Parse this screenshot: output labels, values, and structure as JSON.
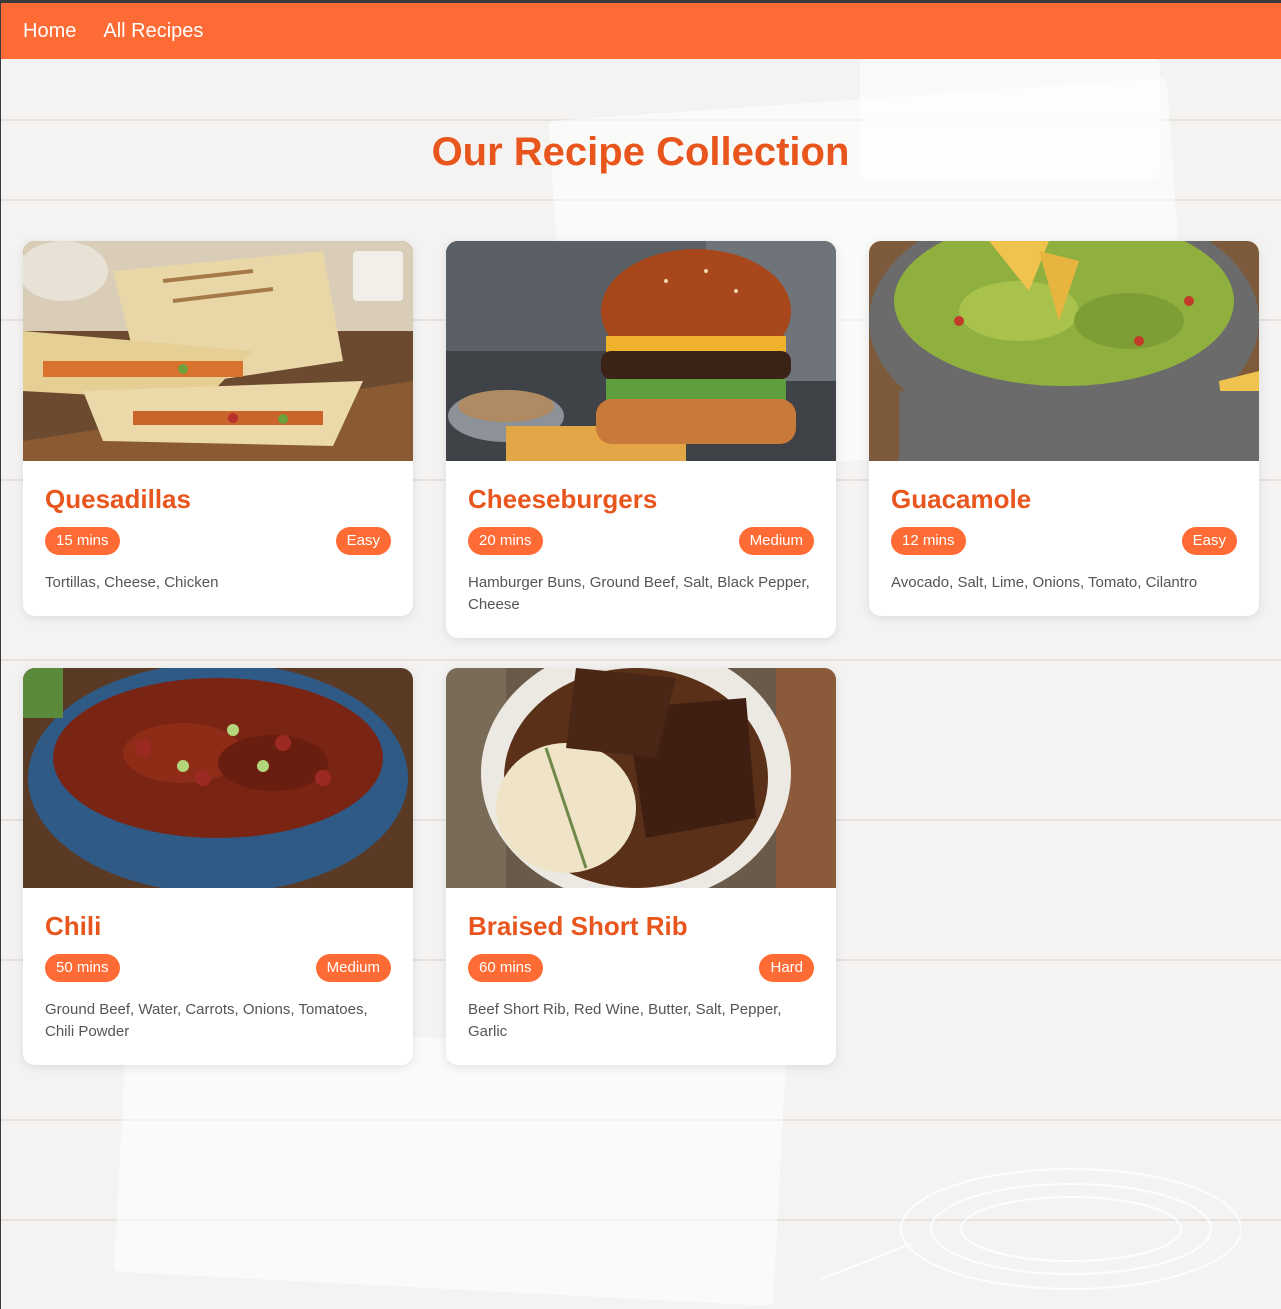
{
  "nav": {
    "home": "Home",
    "all_recipes": "All Recipes"
  },
  "page": {
    "title": "Our Recipe Collection"
  },
  "colors": {
    "accent": "#ff6b35",
    "title": "#e8561e",
    "text": "#555555"
  },
  "recipes": [
    {
      "name": "Quesadillas",
      "time": "15 mins",
      "difficulty": "Easy",
      "ingredients": "Tortillas, Cheese, Chicken",
      "image": "quesadilla-photo"
    },
    {
      "name": "Cheeseburgers",
      "time": "20 mins",
      "difficulty": "Medium",
      "ingredients": "Hamburger Buns, Ground Beef, Salt, Black Pepper, Cheese",
      "image": "cheeseburger-photo"
    },
    {
      "name": "Guacamole",
      "time": "12 mins",
      "difficulty": "Easy",
      "ingredients": "Avocado, Salt, Lime, Onions, Tomato, Cilantro",
      "image": "guacamole-photo"
    },
    {
      "name": "Chili",
      "time": "50 mins",
      "difficulty": "Medium",
      "ingredients": "Ground Beef, Water, Carrots, Onions, Tomatoes, Chili Powder",
      "image": "chili-photo"
    },
    {
      "name": "Braised Short Rib",
      "time": "60 mins",
      "difficulty": "Hard",
      "ingredients": "Beef Short Rib, Red Wine, Butter, Salt, Pepper, Garlic",
      "image": "short-rib-photo"
    }
  ]
}
